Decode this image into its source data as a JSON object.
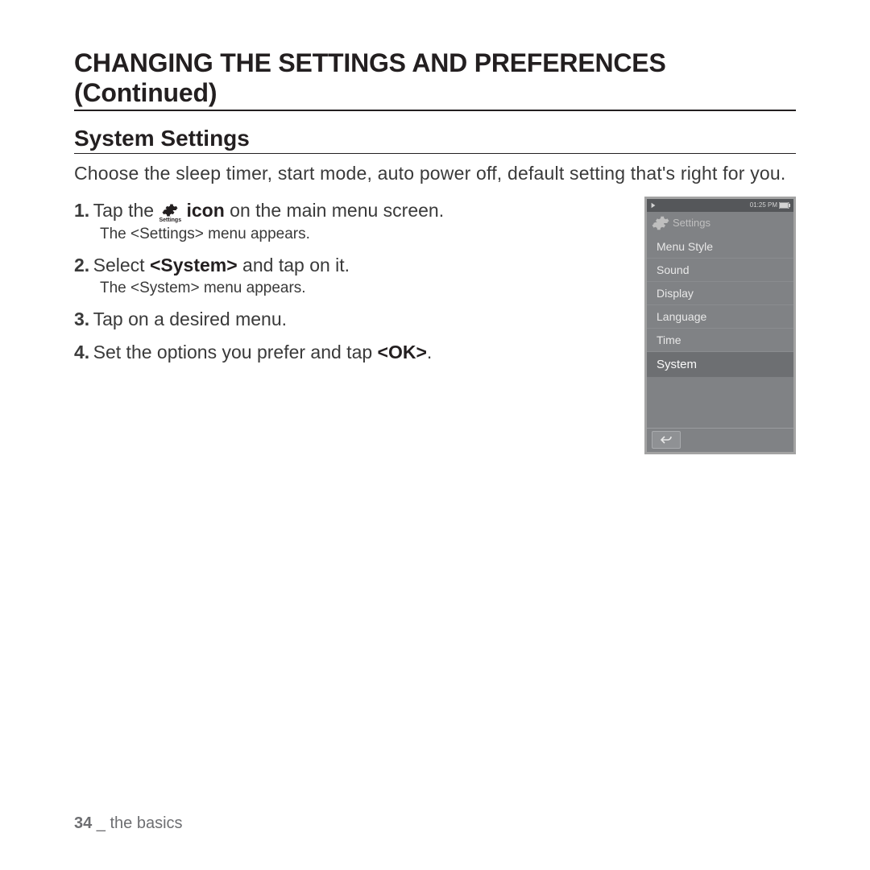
{
  "page_title": "CHANGING THE SETTINGS AND PREFERENCES (Continued)",
  "section_title": "System Settings",
  "intro": "Choose the sleep timer, start mode, auto power off, default setting that's right for you.",
  "gear_label": "Settings",
  "steps": {
    "one": {
      "num": "1.",
      "a": "Tap the ",
      "b": " icon",
      "c": " on the main menu screen.",
      "sub": "The <Settings> menu appears."
    },
    "two": {
      "num": "2.",
      "a": "Select ",
      "b": "<System>",
      "c": " and tap on it.",
      "sub": "The <System> menu appears."
    },
    "three": {
      "num": "3.",
      "text": "Tap on a desired menu."
    },
    "four": {
      "num": "4.",
      "a": "Set the options you prefer and tap ",
      "b": "<OK>",
      "c": "."
    }
  },
  "device": {
    "time": "01:25 PM",
    "header": "Settings",
    "items": [
      "Menu Style",
      "Sound",
      "Display",
      "Language",
      "Time",
      "System"
    ],
    "selected_index": 5
  },
  "footer": {
    "page": "34",
    "sep": " _ ",
    "section": "the basics"
  }
}
